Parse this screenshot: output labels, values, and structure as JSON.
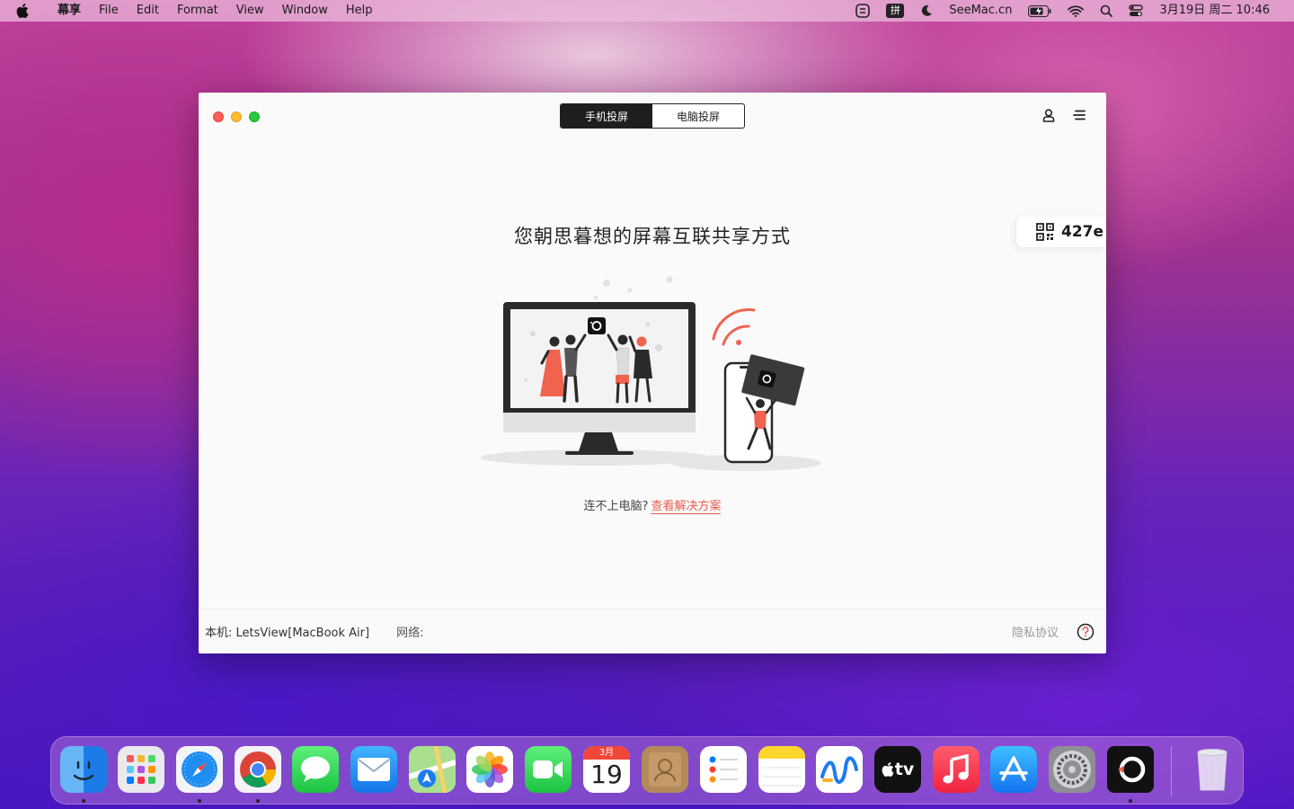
{
  "menubar": {
    "app_name": "幕享",
    "items": [
      "File",
      "Edit",
      "Format",
      "View",
      "Window",
      "Help"
    ],
    "ime_label": "拼",
    "site_label": "SeeMac.cn",
    "datetime": "3月19日 周二 10:46"
  },
  "window": {
    "tabs": [
      {
        "label": "手机投屏",
        "active": true
      },
      {
        "label": "电脑投屏",
        "active": false
      }
    ],
    "code": "427e",
    "headline": "您朝思暮想的屏幕互联共享方式",
    "help_text": "连不上电脑?",
    "help_link": "查看解决方案",
    "footer": {
      "device": "本机: LetsView[MacBook Air]",
      "network": "网络:",
      "privacy": "隐私协议"
    }
  },
  "dock": {
    "apps": [
      {
        "name": "Finder",
        "running": true
      },
      {
        "name": "Launchpad",
        "running": false
      },
      {
        "name": "Safari",
        "running": true
      },
      {
        "name": "Chrome",
        "running": true
      },
      {
        "name": "Messages",
        "running": false
      },
      {
        "name": "Mail",
        "running": false
      },
      {
        "name": "Maps",
        "running": false
      },
      {
        "name": "Photos",
        "running": false
      },
      {
        "name": "FaceTime",
        "running": false
      },
      {
        "name": "Calendar",
        "running": false
      },
      {
        "name": "Contacts",
        "running": false
      },
      {
        "name": "Reminders",
        "running": false
      },
      {
        "name": "Notes",
        "running": false
      },
      {
        "name": "Freeform",
        "running": false
      },
      {
        "name": "TV",
        "running": false
      },
      {
        "name": "Music",
        "running": false
      },
      {
        "name": "App Store",
        "running": false
      },
      {
        "name": "System Preferences",
        "running": false
      },
      {
        "name": "LetsView",
        "running": true
      },
      {
        "name": "Trash",
        "running": false
      }
    ],
    "calendar_month": "3月",
    "calendar_day": "19",
    "tv_label": "tv"
  },
  "colors": {
    "accent": "#ec5b4d",
    "segment_active": "#1e1e1e"
  }
}
